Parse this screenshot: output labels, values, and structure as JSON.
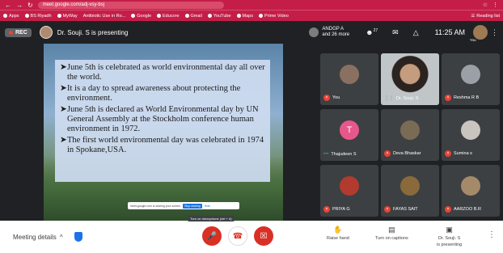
{
  "browser": {
    "address": "meet.google.com/adj-vsy-bsj",
    "bookmarks": [
      "Apps",
      "BS Riyadh",
      "MyWay",
      "Antibiotic Use in Ro...",
      "Google",
      "Educore",
      "Gmail",
      "YouTube",
      "Maps",
      "Prime Video"
    ],
    "reading_list": "Reading list"
  },
  "meet_header": {
    "rec_label": "REC",
    "presenting_text": "Dr. Souji. S is presenting",
    "others_line1": "ANDGP A",
    "others_line2": "and 26 more",
    "participants_count": "27",
    "time": "11:25 AM",
    "you_label": "You"
  },
  "slide": {
    "bullets": [
      "June 5th is celebrated as world environmental day all over the world.",
      "It is a day to spread awareness about protecting the environment.",
      "June 5th is declared as World Environmental day by UN General Assembly at the Stockholm conference human environment in 1972.",
      "The first world environmental day was celebrated in 1974 in Spokane,USA."
    ],
    "share_notice": "meet.google.com is sharing your screen",
    "stop_sharing": "Stop sharing",
    "hide": "Hide"
  },
  "participants": [
    {
      "name": "You",
      "muted": true,
      "letter": ""
    },
    {
      "name": "Dr. Souji. S",
      "muted": false,
      "letter": ""
    },
    {
      "name": "Reshma R B",
      "muted": true,
      "letter": ""
    },
    {
      "name": "Thajudeen S",
      "muted": false,
      "letter": "T"
    },
    {
      "name": "Deva Bhaskar",
      "muted": true,
      "letter": ""
    },
    {
      "name": "Sumina s",
      "muted": true,
      "letter": ""
    },
    {
      "name": "PRIYA G",
      "muted": true,
      "letter": ""
    },
    {
      "name": "FAYAS SAIT",
      "muted": true,
      "letter": ""
    },
    {
      "name": "AARZOO B.R",
      "muted": true,
      "letter": ""
    }
  ],
  "bottom_bar": {
    "meeting_details": "Meeting details",
    "tooltip": "Turn on microphone (ctrl + d)",
    "raise_hand": "Raise hand",
    "captions": "Turn on captions",
    "presenting_line1": "Dr. Souji. S",
    "presenting_line2": "is presenting"
  },
  "colors": {
    "browser_bar": "#c41e48",
    "meet_dark": "#202124",
    "tile": "#3c4043",
    "danger": "#d93025",
    "accent_blue": "#1a73e8"
  }
}
